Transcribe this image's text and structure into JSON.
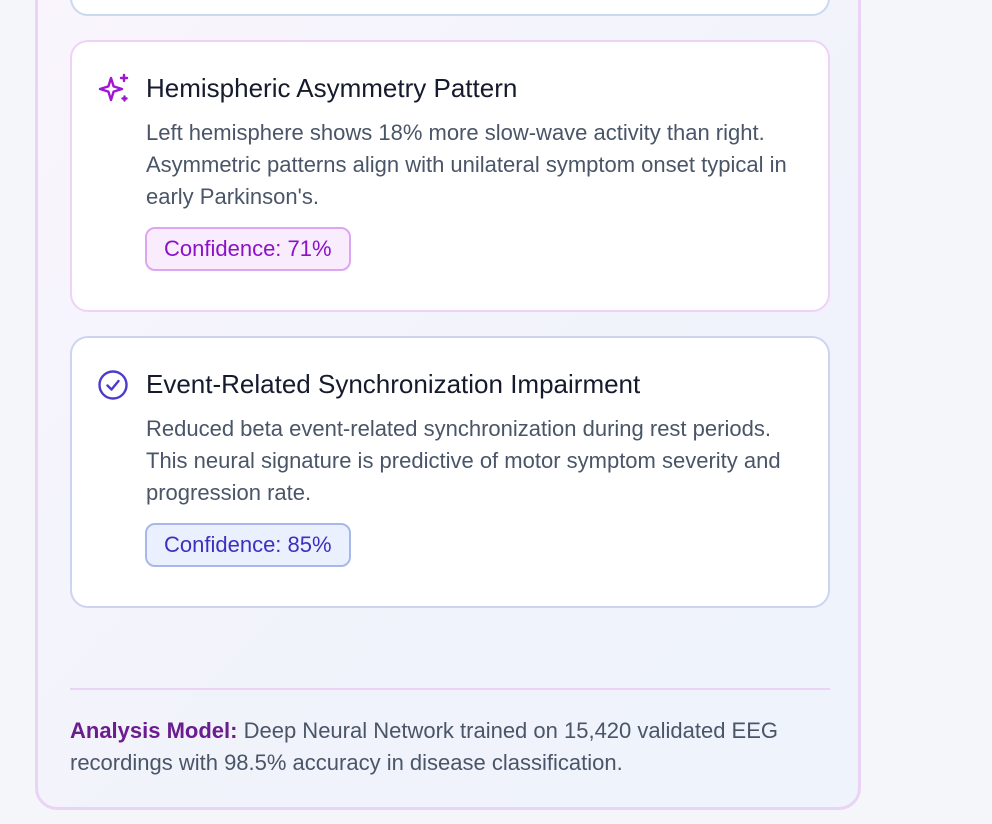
{
  "insights": [
    {
      "icon": "sparkles-icon",
      "title": "Hemispheric Asymmetry Pattern",
      "description": "Left hemisphere shows 18% more slow-wave activity than right. Asymmetric patterns align with unilateral symptom onset typical in early Parkinson's.",
      "confidence_label": "Confidence: 71%",
      "accent": "#a213d6"
    },
    {
      "icon": "check-circle-icon",
      "title": "Event-Related Synchronization Impairment",
      "description": "Reduced beta event-related synchronization during rest periods. This neural signature is predictive of motor symptom severity and progression rate.",
      "confidence_label": "Confidence: 85%",
      "accent": "#4b3cc9"
    }
  ],
  "footer": {
    "label": "Analysis Model:",
    "text": " Deep Neural Network trained on 15,420 validated EEG recordings with 98.5% accuracy in disease classification."
  }
}
